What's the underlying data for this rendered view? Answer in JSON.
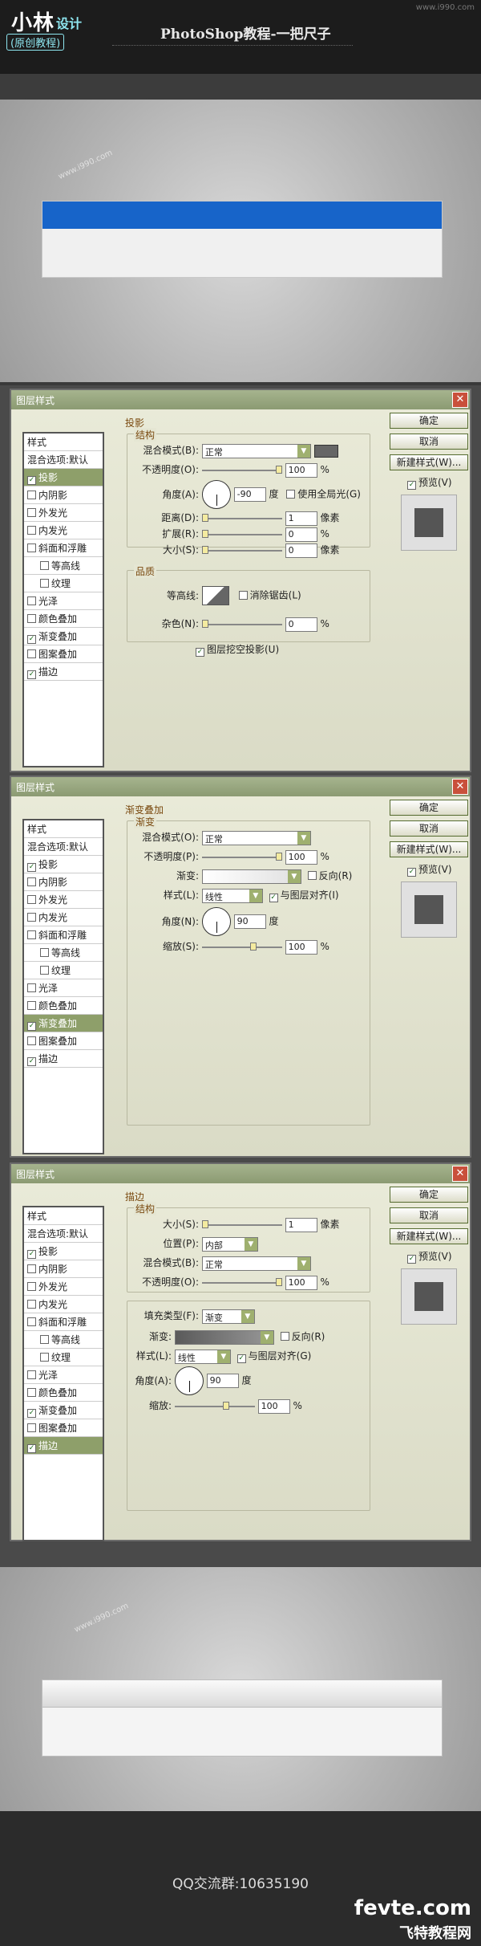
{
  "header": {
    "logo_main": "小林",
    "logo_sub": "设计",
    "logo_tag": "(原创教程)",
    "site_mark": "www.i990.com",
    "title": "PhotoShop教程-一把尺子"
  },
  "watermark": "www.i990.com",
  "dialog_title": "图层样式",
  "buttons": {
    "ok": "确定",
    "cancel": "取消",
    "new_style": "新建样式(W)...",
    "preview": "预览(V)"
  },
  "side_items": [
    "样式",
    "混合选项:默认",
    "投影",
    "内阴影",
    "外发光",
    "内发光",
    "斜面和浮雕",
    "等高线",
    "纹理",
    "光泽",
    "颜色叠加",
    "渐变叠加",
    "图案叠加",
    "描边"
  ],
  "dialog1": {
    "section": "投影",
    "structure": "结构",
    "blend_mode_label": "混合模式(B):",
    "blend_mode": "正常",
    "opacity_label": "不透明度(O):",
    "opacity": "100",
    "angle_label": "角度(A):",
    "angle": "-90",
    "deg": "度",
    "global_light": "使用全局光(G)",
    "distance_label": "距离(D):",
    "distance": "1",
    "spread_label": "扩展(R):",
    "spread": "0",
    "size_label": "大小(S):",
    "size": "0",
    "px": "像素",
    "pct": "%",
    "quality": "品质",
    "contour_label": "等高线:",
    "antialias": "消除锯齿(L)",
    "noise_label": "杂色(N):",
    "noise": "0",
    "knockout": "图层挖空投影(U)"
  },
  "dialog2": {
    "section": "渐变叠加",
    "gradient_group": "渐变",
    "blend_mode_label": "混合模式(O):",
    "blend_mode": "正常",
    "opacity_label": "不透明度(P):",
    "opacity": "100",
    "gradient_label": "渐变:",
    "reverse": "反向(R)",
    "style_label": "样式(L):",
    "style": "线性",
    "align": "与图层对齐(I)",
    "angle_label": "角度(N):",
    "angle": "90",
    "deg": "度",
    "scale_label": "缩放(S):",
    "scale": "100",
    "pct": "%"
  },
  "dialog3": {
    "section": "描边",
    "structure": "结构",
    "size_label": "大小(S):",
    "size": "1",
    "px": "像素",
    "position_label": "位置(P):",
    "position": "内部",
    "blend_mode_label": "混合模式(B):",
    "blend_mode": "正常",
    "opacity_label": "不透明度(O):",
    "opacity": "100",
    "fill_type_label": "填充类型(F):",
    "fill_type": "渐变",
    "gradient_label": "渐变:",
    "reverse": "反向(R)",
    "style_label": "样式(L):",
    "style": "线性",
    "align": "与图层对齐(G)",
    "angle_label": "角度(A):",
    "angle": "90",
    "deg": "度",
    "scale_label": "缩放:",
    "scale": "100",
    "pct": "%"
  },
  "footer": {
    "qq": "QQ交流群:10635190",
    "brand": "fevte.com",
    "brand_cn": "飞特教程网"
  },
  "colors": {
    "ruler_blue": "#1764c9",
    "title_bar": "#8b9a72",
    "active_item": "#8e9f6a"
  }
}
